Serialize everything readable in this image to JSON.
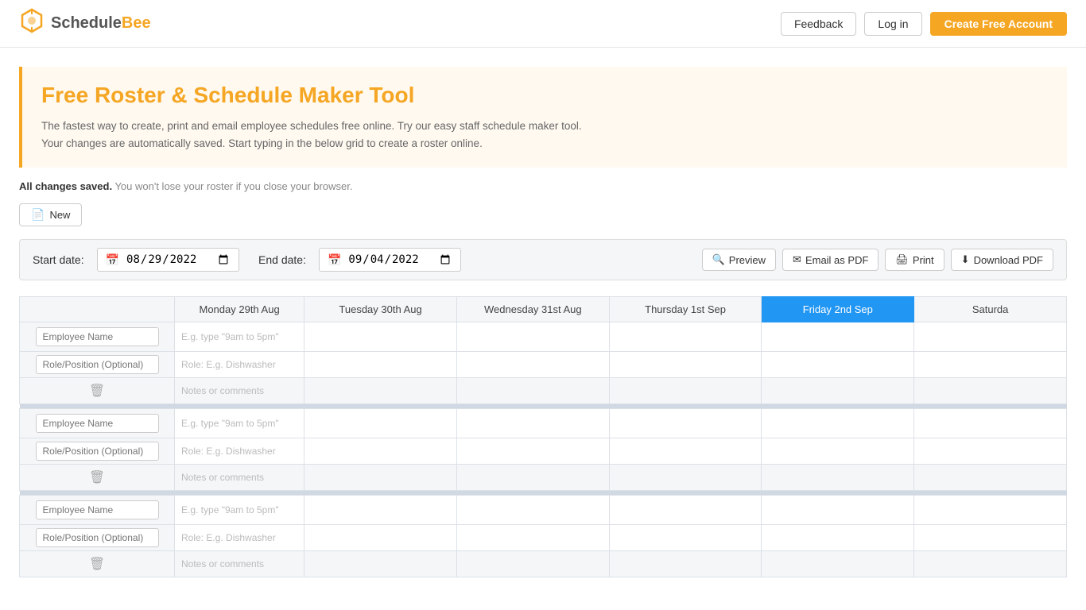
{
  "header": {
    "logo_schedule": "Schedule",
    "logo_bee": "Bee",
    "feedback_label": "Feedback",
    "login_label": "Log in",
    "create_account_label": "Create Free Account"
  },
  "hero": {
    "title_pre": "Free ",
    "title_highlight": "Roster & Schedule Maker",
    "title_post": " Tool",
    "description_line1": "The fastest way to create, print and email employee schedules free online. Try our easy staff schedule maker tool.",
    "description_line2": "Your changes are automatically saved. Start typing in the below grid to create a roster online."
  },
  "status": {
    "saved": "All changes saved.",
    "note": "You won't lose your roster if you close your browser."
  },
  "toolbar": {
    "new_label": "New"
  },
  "dates": {
    "start_label": "Start date:",
    "start_value": "08/29/2022",
    "end_label": "End date:",
    "end_value": "09/04/2022",
    "preview_label": "Preview",
    "email_label": "Email as PDF",
    "print_label": "Print",
    "download_label": "Download PDF"
  },
  "grid": {
    "col_headers": [
      "",
      "Monday 29th Aug",
      "Tuesday 30th Aug",
      "Wednesday 31st Aug",
      "Thursday 1st Sep",
      "Friday 2nd Sep",
      "Saturda"
    ],
    "today_col": 5,
    "employee_placeholder": "Employee Name",
    "role_placeholder": "Role/Position (Optional)",
    "shift_placeholder_1": "E.g. type \"9am to 5pm\"",
    "role_eg": "Role: E.g. Dishwasher",
    "notes_eg": "Notes or comments",
    "rows": [
      {
        "id": 1
      },
      {
        "id": 2
      },
      {
        "id": 3
      }
    ]
  }
}
